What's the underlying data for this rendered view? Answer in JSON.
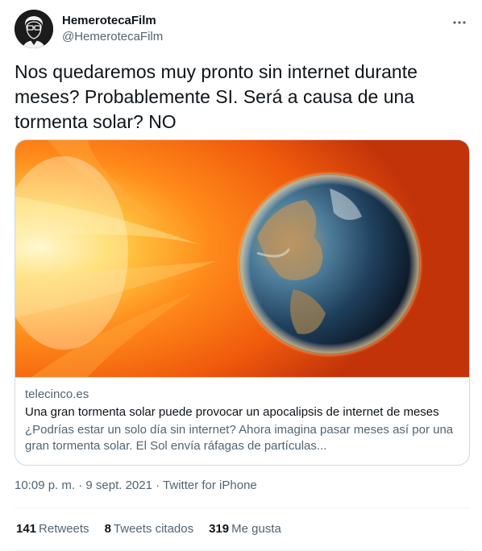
{
  "author": {
    "display_name": "HemerotecaFilm",
    "handle": "@HemerotecaFilm"
  },
  "more_icon": "more-horizontal-icon",
  "tweet": {
    "text": "Nos quedaremos muy pronto sin internet durante meses? Probablemente SI. Será a causa de una tormenta solar? NO"
  },
  "card": {
    "domain": "telecinco.es",
    "title": "Una gran tormenta solar puede provocar un apocalipsis de internet de meses",
    "description": "¿Podrías estar un solo día sin internet? Ahora imagina pasar meses así por una gran tormenta solar. El Sol envía ráfagas de partículas..."
  },
  "meta": {
    "time": "10:09 p. m.",
    "sep1": " · ",
    "date": "9 sept. 2021",
    "sep2": " · ",
    "source": "Twitter for iPhone"
  },
  "stats": {
    "retweets_count": "141",
    "retweets_label": "Retweets",
    "quotes_count": "8",
    "quotes_label": "Tweets citados",
    "likes_count": "319",
    "likes_label": "Me gusta"
  },
  "colors": {
    "text": "#0f1419",
    "secondary": "#536471",
    "border": "#cfd9de",
    "divider": "#eff3f4"
  }
}
